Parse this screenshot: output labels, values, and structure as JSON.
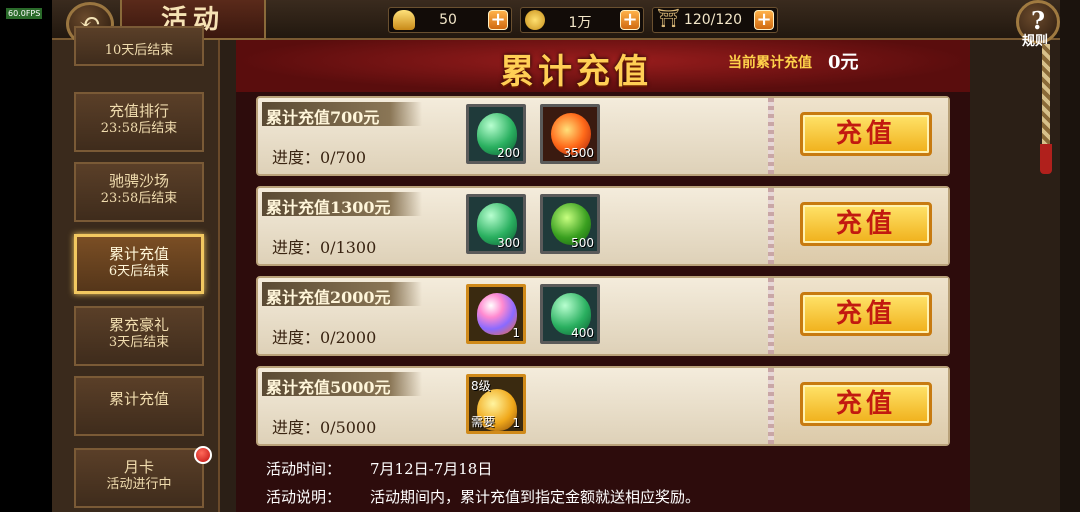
{
  "fps": "60.0FPS",
  "header": {
    "title": "活动",
    "back_icon": "back-arrow-icon",
    "help_label": "规则",
    "help_icon": "?",
    "resources": [
      {
        "name": "gold-ingot",
        "value": "50",
        "color": "#e8b23a"
      },
      {
        "name": "coin",
        "value": "1万",
        "color": "#f0c030"
      },
      {
        "name": "stamina",
        "value": "120/120",
        "color": "#c8a060"
      }
    ],
    "plus": "+"
  },
  "sidebar": {
    "items": [
      {
        "l1": "10天后结束",
        "l2": ""
      },
      {
        "l1": "充值排行",
        "l2": "23:58后结束"
      },
      {
        "l1": "驰骋沙场",
        "l2": "23:58后结束"
      },
      {
        "l1": "累计充值",
        "l2": "6天后结束"
      },
      {
        "l1": "累充豪礼",
        "l2": "3天后结束"
      },
      {
        "l1": "累计充值",
        "l2": ""
      },
      {
        "l1": "月卡",
        "l2": "活动进行中"
      }
    ],
    "active_index": 3
  },
  "main": {
    "title": "累计充值",
    "current_label": "当前累计充值",
    "current_value": "0元",
    "charge_label": "充值",
    "rows": [
      {
        "label": "累计充值700元",
        "progress": "进度：0/700",
        "items": [
          {
            "kind": "green-gem",
            "count": "200"
          },
          {
            "kind": "fire-orb",
            "count": "3500"
          }
        ]
      },
      {
        "label": "累计充值1300元",
        "progress": "进度：0/1300",
        "items": [
          {
            "kind": "green-gem",
            "count": "300"
          },
          {
            "kind": "green-bun",
            "count": "500"
          }
        ]
      },
      {
        "label": "累计充值2000元",
        "progress": "进度：0/2000",
        "items": [
          {
            "kind": "rainbow-gem",
            "count": "1"
          },
          {
            "kind": "green-gem",
            "count": "400"
          }
        ]
      },
      {
        "label": "累计充值5000元",
        "progress": "进度：0/5000",
        "items": [
          {
            "kind": "gold-stone",
            "count": "1",
            "level": "8级",
            "need": "需要"
          }
        ]
      }
    ],
    "time_label": "活动时间：",
    "time_value": "7月12日-7月18日",
    "desc_label": "活动说明：",
    "desc_value": "活动期间内，累计充值到指定金额就送相应奖励。"
  }
}
